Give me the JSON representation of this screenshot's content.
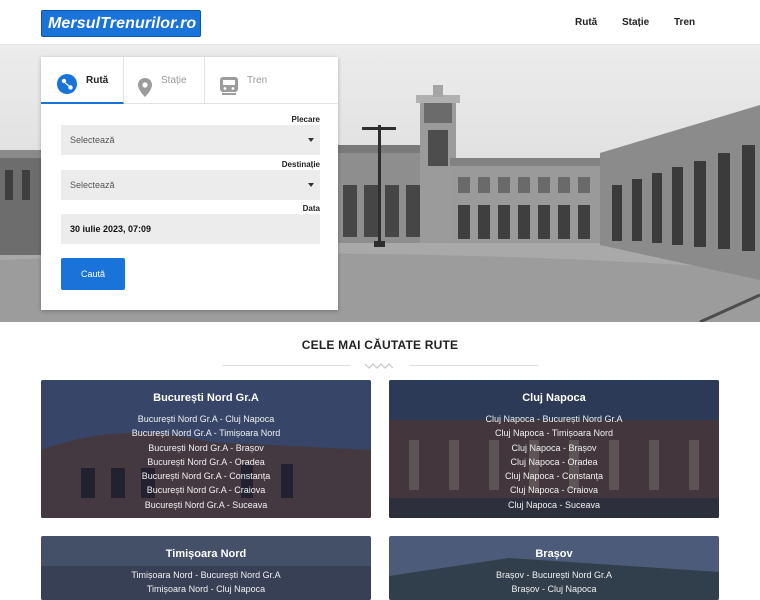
{
  "header": {
    "logo_text": "MersulTrenurilor.ro",
    "nav": [
      "Rută",
      "Stație",
      "Tren"
    ]
  },
  "search": {
    "tabs": [
      {
        "label": "Rută",
        "icon": "route-map-icon",
        "active": true
      },
      {
        "label": "Stație",
        "icon": "location-pin-icon",
        "active": false
      },
      {
        "label": "Tren",
        "icon": "train-icon",
        "active": false
      }
    ],
    "departure_label": "Plecare",
    "departure_value": "Selectează",
    "destination_label": "Destinație",
    "destination_value": "Selectează",
    "date_label": "Data",
    "date_value": "30 iulie 2023, 07:09",
    "search_button": "Caută"
  },
  "popular": {
    "title": "CELE MAI CĂUTATE RUTE",
    "cards": [
      {
        "title": "București Nord Gr.A",
        "routes": [
          "București Nord Gr.A - Cluj Napoca",
          "București Nord Gr.A - Timișoara Nord",
          "București Nord Gr.A - Brașov",
          "București Nord Gr.A - Oradea",
          "București Nord Gr.A - Constanța",
          "București Nord Gr.A - Craiova",
          "București Nord Gr.A - Suceava"
        ]
      },
      {
        "title": "Cluj Napoca",
        "routes": [
          "Cluj Napoca - București Nord Gr.A",
          "Cluj Napoca - Timișoara Nord",
          "Cluj Napoca - Brașov",
          "Cluj Napoca - Oradea",
          "Cluj Napoca - Constanța",
          "Cluj Napoca - Craiova",
          "Cluj Napoca - Suceava"
        ]
      },
      {
        "title": "Timișoara Nord",
        "routes": [
          "Timișoara Nord - București Nord Gr.A",
          "Timișoara Nord - Cluj Napoca"
        ]
      },
      {
        "title": "Brașov",
        "routes": [
          "Brașov - București Nord Gr.A",
          "Brașov - Cluj Napoca"
        ]
      }
    ]
  },
  "colors": {
    "accent": "#1a73d8",
    "card_overlay": "#101c3a"
  }
}
